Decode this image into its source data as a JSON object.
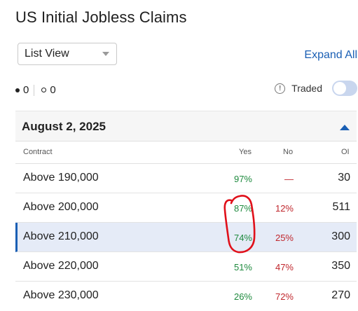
{
  "header": {
    "title": "US Initial Jobless Claims"
  },
  "view_select": {
    "value": "List View"
  },
  "expand_all": {
    "label": "Expand All"
  },
  "filters": {
    "filled_count": "0",
    "open_count": "0"
  },
  "traded": {
    "label": "Traded",
    "info_glyph": "!",
    "enabled": false
  },
  "group": {
    "date": "August 2, 2025",
    "expanded": true
  },
  "columns": {
    "contract": "Contract",
    "yes": "Yes",
    "no": "No",
    "oi": "OI"
  },
  "rows": [
    {
      "label": "Above 190,000",
      "yes": "97%",
      "no": "—",
      "oi": "30",
      "selected": false
    },
    {
      "label": "Above 200,000",
      "yes": "87%",
      "no": "12%",
      "oi": "511",
      "selected": false
    },
    {
      "label": "Above 210,000",
      "yes": "74%",
      "no": "25%",
      "oi": "300",
      "selected": true
    },
    {
      "label": "Above 220,000",
      "yes": "51%",
      "no": "47%",
      "oi": "350",
      "selected": false
    },
    {
      "label": "Above 230,000",
      "yes": "26%",
      "no": "72%",
      "oi": "270",
      "selected": false
    }
  ],
  "colors": {
    "accent": "#1a5fb4",
    "yes": "#1e8a3e",
    "no": "#c0272d",
    "selected_row": "#e5ebf7",
    "annotation": "#e0101a"
  }
}
